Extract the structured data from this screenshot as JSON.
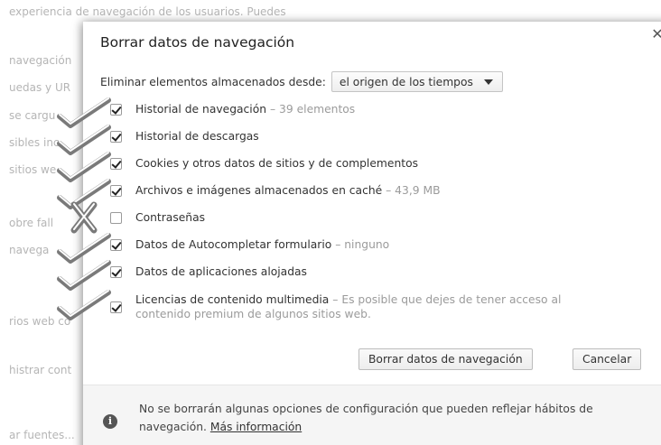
{
  "background": {
    "lines": [
      "experiencia de navegación de los usuarios. Puedes",
      "navegación",
      "uedas y UR",
      "se cargu",
      "sibles inc",
      "sitios we",
      "obre fall",
      "navega",
      "rios web co",
      "histrar cont",
      "ar fuentes..."
    ]
  },
  "dialog": {
    "title": "Borrar datos de navegación",
    "close_icon": "close-icon",
    "from_label": "Eliminar elementos almacenados desde:",
    "from_value": "el origen de los tiempos",
    "options": [
      {
        "label": "Historial de navegación",
        "detail": "– 39 elementos",
        "checked": true,
        "mark": "check"
      },
      {
        "label": "Historial de descargas",
        "detail": "",
        "checked": true,
        "mark": "check"
      },
      {
        "label": "Cookies y otros datos de sitios y de complementos",
        "detail": "",
        "checked": true,
        "mark": "check"
      },
      {
        "label": "Archivos e imágenes almacenados en caché",
        "detail": "– 43,9 MB",
        "checked": true,
        "mark": "check"
      },
      {
        "label": "Contraseñas",
        "detail": "",
        "checked": false,
        "mark": "cross"
      },
      {
        "label": "Datos de Autocompletar formulario",
        "detail": "– ninguno",
        "checked": true,
        "mark": "check"
      },
      {
        "label": "Datos de aplicaciones alojadas",
        "detail": "",
        "checked": true,
        "mark": "check"
      },
      {
        "label": "Licencias de contenido multimedia",
        "detail": "– Es posible que dejes de tener acceso al contenido premium de algunos sitios web.",
        "checked": true,
        "mark": "check"
      }
    ],
    "clear_button": "Borrar datos de navegación",
    "cancel_button": "Cancelar",
    "footer_text": "No se borrarán algunas opciones de configuración que pueden reflejar hábitos de navegación.",
    "footer_link": "Más información",
    "info_icon": "info-icon"
  },
  "colors": {
    "detail_text": "#9b9b9b",
    "footer_bg": "#f5f5f5",
    "mark_shadow": "#7a7a7a"
  }
}
